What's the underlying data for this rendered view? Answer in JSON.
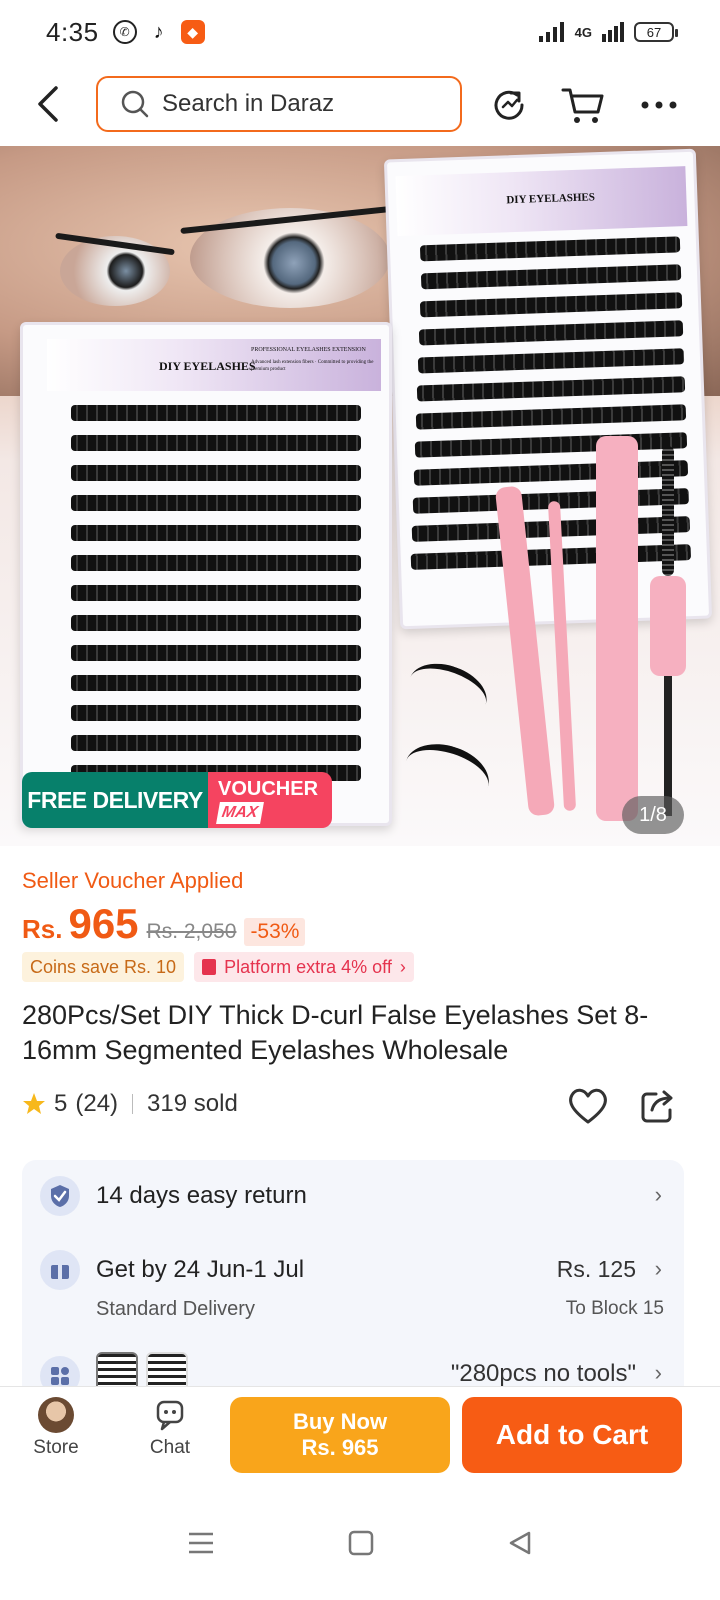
{
  "status": {
    "time": "4:35",
    "network": "4G",
    "battery": "67"
  },
  "search": {
    "placeholder": "Search in Daraz"
  },
  "hero": {
    "box_brand": "DIY EYELASHES",
    "box_tagline": "PROFESSIONAL EYELASHES EXTENSION",
    "box_note": "Advanced lash extension fibers · Committed to providing the premium product",
    "badge_free": "FREE DELIVERY",
    "badge_voucher": "VOUCHER",
    "badge_max": "MAX",
    "pager": "1/8"
  },
  "product": {
    "voucher_applied": "Seller Voucher Applied",
    "currency": "Rs.",
    "price": "965",
    "old_price": "Rs. 2,050",
    "discount": "-53%",
    "coins": "Coins save Rs. 10",
    "platform": "Platform extra 4% off",
    "title": "280Pcs/Set DIY Thick D-curl False Eyelashes Set 8-16mm Segmented Eyelashes Wholesale",
    "rating": "5",
    "reviews": "(24)",
    "sold": "319 sold"
  },
  "services": {
    "return": "14 days easy return",
    "delivery": "Get by 24 Jun-1 Jul",
    "delivery_type": "Standard Delivery",
    "delivery_fee": "Rs. 125",
    "delivery_to": "To Block 15",
    "variant": "\"280pcs no tools\""
  },
  "bottom": {
    "store": "Store",
    "chat": "Chat",
    "buy_now": "Buy Now",
    "buy_price": "Rs. 965",
    "add_to_cart": "Add to Cart"
  },
  "colors": {
    "accent": "#f36a1c",
    "free_green": "#07806b",
    "voucher_red": "#f54460",
    "buy_yellow": "#f9a51b",
    "cart_orange": "#f75c14"
  }
}
